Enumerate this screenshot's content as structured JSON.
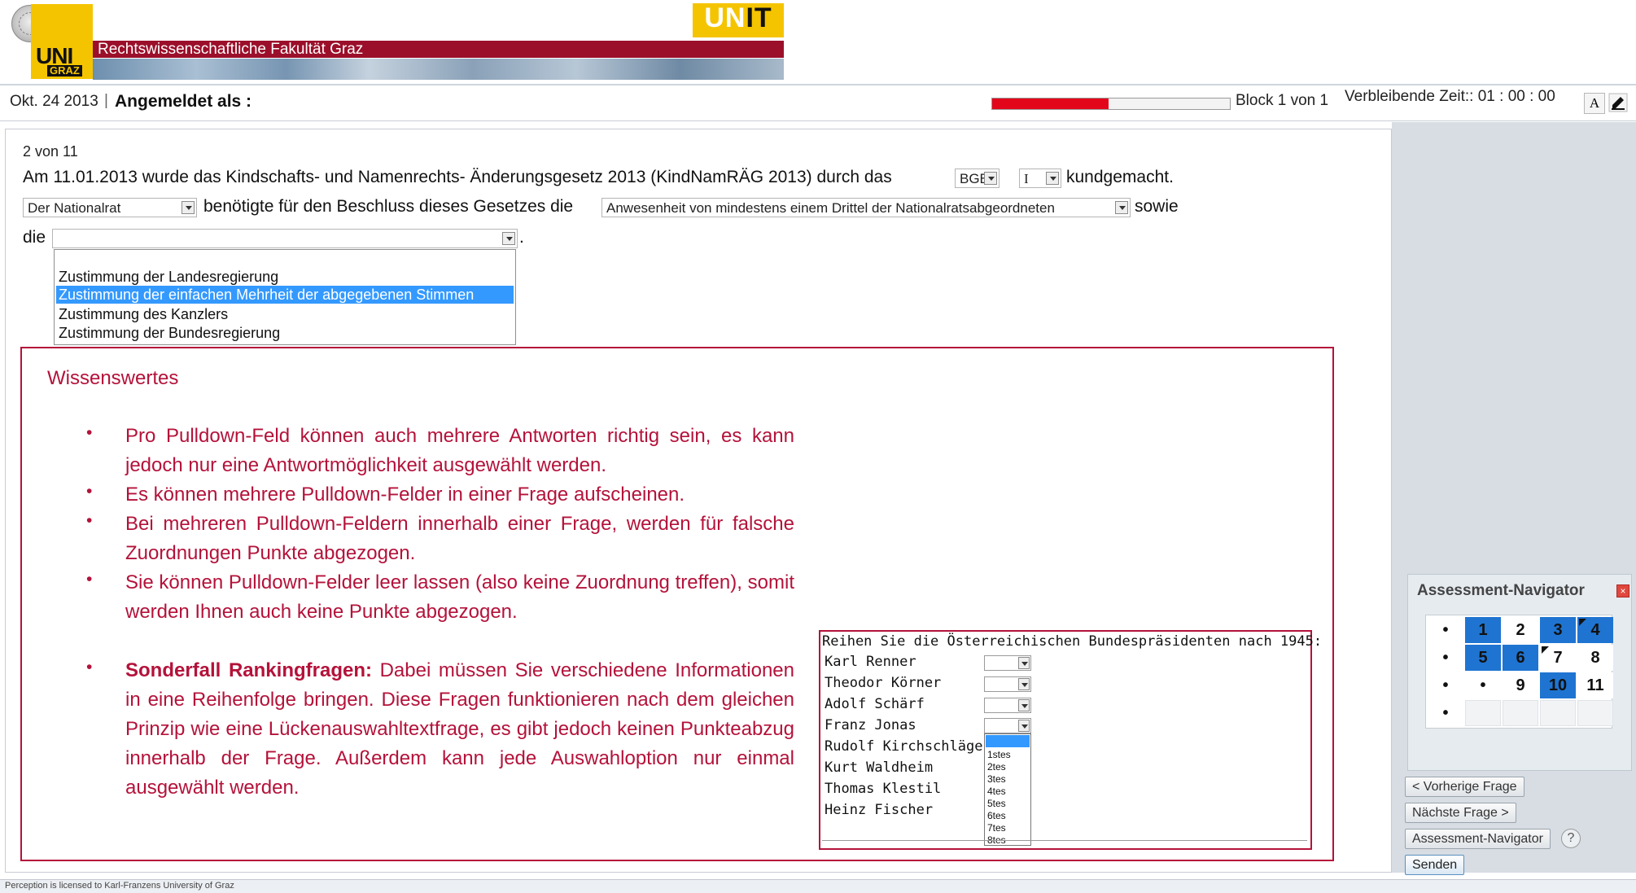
{
  "banner": {
    "university_logo": "UNI",
    "university_logo_sub": "GRAZ",
    "faculty_title": "Rechtswissenschaftliche Fakultät Graz",
    "unit_logo_uni": "UN",
    "unit_logo_it": "IT"
  },
  "status_bar": {
    "date": "Okt. 24 2013",
    "separator": "|",
    "logged_in_label": "Angemeldet als :",
    "progress_fraction": 0.49,
    "progress_color": "#e3061b",
    "block_text": "Block 1 von 1",
    "remaining_time": "Verbleibende Zeit:: 01 : 00 : 00",
    "font_button": "A",
    "edit_icon": "edit-icon"
  },
  "question": {
    "counter": "2  von 11",
    "line1_text": "Am 11.01.2013 wurde das Kindschafts- und Namenrechts- Änderungsgesetz 2013 (KindNamRÄG 2013) durch das",
    "select_bgbl": "BGBl.",
    "select_roman": "I",
    "line1_end": "kundgemacht.",
    "select_nationalrat": "Der Nationalrat",
    "line2_text": "benötigte für den Beschluss dieses Gesetzes die",
    "select_anwesenheit": "Anwesenheit von mindestens einem Drittel der Nationalratsabgeordneten",
    "line2_end": "sowie",
    "line3_start": "die",
    "line3_end": ".",
    "select_die": "",
    "dropdown_options": [
      "Zustimmung der Landesregierung",
      "Zustimmung der einfachen Mehrheit der abgegebenen Stimmen",
      "Zustimmung des Kanzlers",
      "Zustimmung der Bundesregierung"
    ],
    "dropdown_selected": "Zustimmung der einfachen Mehrheit der abgegebenen Stimmen"
  },
  "info": {
    "title": "Wissenswertes",
    "bullet_glyph": "•",
    "bullets": [
      "Pro Pulldown-Feld können auch mehrere Antworten richtig sein, es kann jedoch nur eine Antwortmöglichkeit ausgewählt werden.",
      "Es können mehrere Pulldown-Felder in einer Frage aufscheinen.",
      "Bei mehreren Pulldown-Feldern innerhalb einer Frage, werden für falsche Zuordnungen Punkte abgezogen.",
      "Sie können Pulldown-Felder leer lassen (also keine Zuordnung treffen), somit werden Ihnen auch keine Punkte abgezogen."
    ],
    "special_case_label": "Sonderfall Rankingfragen:",
    "special_case_text": " Dabei müssen Sie verschiedene Informationen in eine Reihenfolge bringen. Diese Fragen funktionieren nach dem gleichen Prinzip wie eine Lückenauswahltextfrage, es gibt jedoch keinen Punkteabzug innerhalb der Frage. Außerdem kann jede Auswahloption nur einmal ausgewählt werden."
  },
  "ranking": {
    "title": "Reihen Sie die Österreichischen Bundespräsidenten nach 1945:",
    "names": [
      "Karl Renner",
      "Theodor Körner",
      "Adolf Schärf",
      "Franz Jonas",
      "Rudolf Kirchschläger",
      "Kurt Waldheim",
      "Thomas Klestil",
      "Heinz Fischer"
    ],
    "options": [
      "1stes",
      "2tes",
      "3tes",
      "4tes",
      "5tes",
      "6tes",
      "7tes",
      "8tes"
    ]
  },
  "navigator": {
    "title": "Assessment-Navigator",
    "close_icon": "close-icon",
    "rows": [
      [
        "•",
        "1",
        "2",
        "3",
        "4"
      ],
      [
        "•",
        "5",
        "6",
        "7",
        "8"
      ],
      [
        "•",
        "•",
        "9",
        "10",
        "11"
      ],
      [
        "•",
        "",
        "",
        "",
        ""
      ]
    ],
    "prev_button": "< Vorherige Frage",
    "next_button": "Nächste Frage >",
    "navigator_button": "Assessment-Navigator",
    "help_icon": "help-icon",
    "send_button": "Senden",
    "answered_color": "#1f74d1"
  },
  "footer": {
    "text": "Perception is licensed to Karl-Franzens University of Graz"
  }
}
